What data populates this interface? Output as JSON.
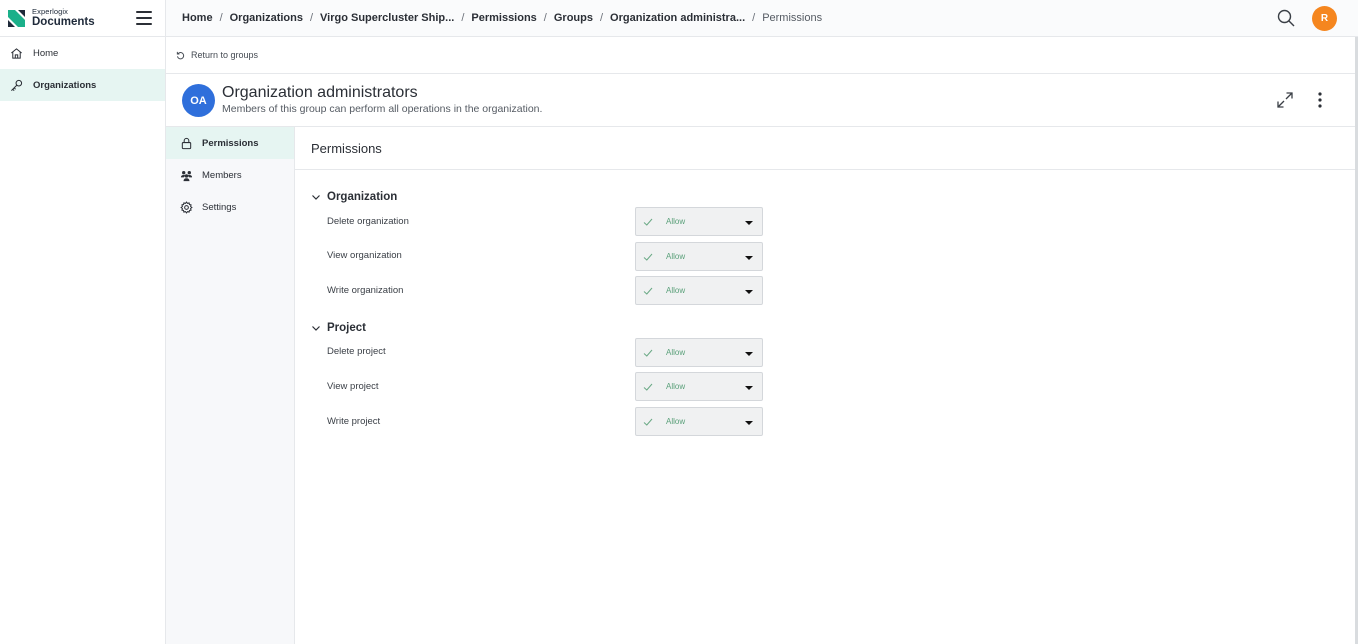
{
  "brand": {
    "small": "Experlogix",
    "big": "Documents"
  },
  "sidebar": {
    "items": [
      {
        "label": "Home",
        "icon": "home-icon",
        "active": false
      },
      {
        "label": "Organizations",
        "icon": "key-icon",
        "active": true
      }
    ]
  },
  "breadcrumbs": [
    "Home",
    "Organizations",
    "Virgo Supercluster Ship...",
    "Permissions",
    "Groups",
    "Organization administra...",
    "Permissions"
  ],
  "user": {
    "initial": "R",
    "color": "#f5861f"
  },
  "return_label": "Return to groups",
  "group": {
    "initials": "OA",
    "title": "Organization administrators",
    "description": "Members of this group can perform all operations in the organization.",
    "color": "#2f6fdb"
  },
  "subnav": {
    "items": [
      {
        "label": "Permissions",
        "icon": "lock-icon",
        "active": true
      },
      {
        "label": "Members",
        "icon": "users-icon",
        "active": false
      },
      {
        "label": "Settings",
        "icon": "gear-icon",
        "active": false
      }
    ]
  },
  "main": {
    "title": "Permissions",
    "sections": [
      {
        "title": "Organization",
        "permissions": [
          {
            "label": "Delete organization",
            "value": "Allow"
          },
          {
            "label": "View organization",
            "value": "Allow"
          },
          {
            "label": "Write organization",
            "value": "Allow"
          }
        ]
      },
      {
        "title": "Project",
        "permissions": [
          {
            "label": "Delete project",
            "value": "Allow"
          },
          {
            "label": "View project",
            "value": "Allow"
          },
          {
            "label": "Write project",
            "value": "Allow"
          }
        ]
      }
    ]
  },
  "colors": {
    "accent": "#e6f5f2",
    "allow_text": "#5aa07a",
    "logo": "#1bb08a"
  }
}
